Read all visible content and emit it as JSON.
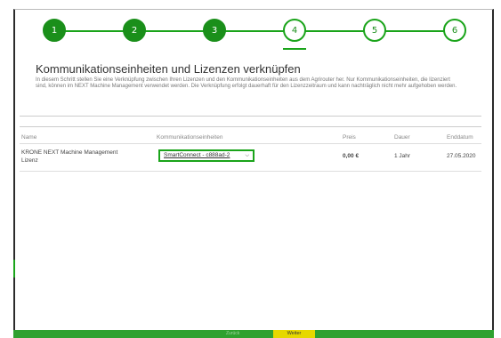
{
  "stepper": {
    "steps": [
      "1",
      "2",
      "3",
      "4",
      "5",
      "6"
    ],
    "current": 4
  },
  "page": {
    "title": "Kommunikationseinheiten und Lizenzen verknüpfen",
    "description": "In diesem Schritt stellen Sie eine Verknüpfung zwischen Ihren Lizenzen und den Kommunikationseinheiten aus dem Agrirouter her. Nur Kommunikationseinheiten, die lizenziert sind, können im NEXT Machine Management verwendet werden. Die Verknüpfung erfolgt dauerhaft für den Lizenzzeitraum und kann nachträglich nicht mehr aufgehoben werden."
  },
  "table": {
    "headers": {
      "name": "Name",
      "unit": "Kommunikationseinheiten",
      "price": "Preis",
      "duration": "Dauer",
      "end": "Enddatum"
    },
    "row": {
      "name_line1": "KRONE NEXT Machine Management",
      "name_line2": "Lizenz",
      "unit_selected": "SmartConnect - c888ad-2",
      "price": "0,00 €",
      "duration": "1 Jahr",
      "end": "27.05.2020"
    }
  },
  "footer": {
    "back_label": "Zurück",
    "next_label": "Weiter"
  },
  "colors": {
    "accent": "#1aa41a",
    "footer": "#2fa12f",
    "next_button": "#e6d800"
  }
}
